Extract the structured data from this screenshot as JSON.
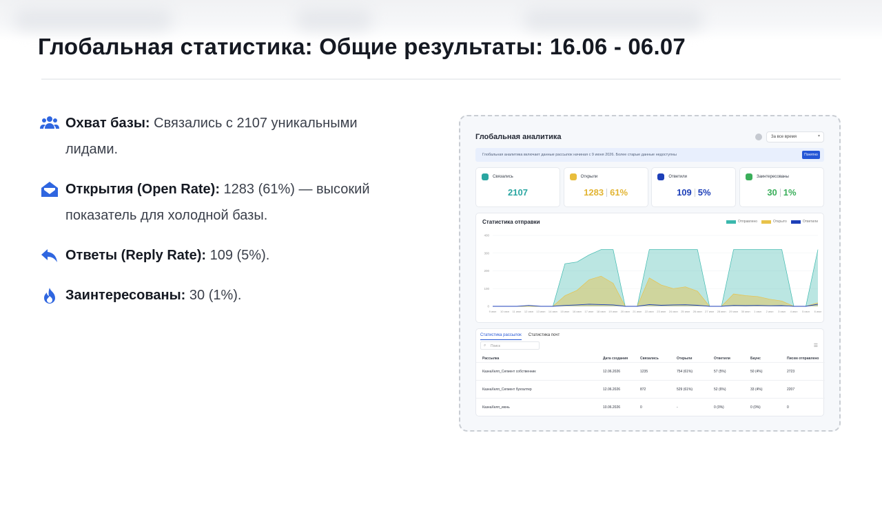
{
  "page": {
    "title": "Глобальная статистика: Общие результаты: 16.06 - 06.07",
    "stats": [
      {
        "icon": "users-icon",
        "label": "Охват базы:",
        "text": " Связались с 2107 уникальными лидами."
      },
      {
        "icon": "envelope-open-icon",
        "label": "Открытия (Open Rate):",
        "text": " 1283 (61%) — высокий показатель для холодной базы."
      },
      {
        "icon": "reply-icon",
        "label": "Ответы (Reply Rate):",
        "text": " 109 (5%)."
      },
      {
        "icon": "fire-icon",
        "label": "Заинтересованы:",
        "text": " 30 (1%)."
      }
    ]
  },
  "analytics": {
    "title": "Глобальная аналитика",
    "period": "За все время",
    "notice": "Глобальная аналитика включает данные рассылок начиная с 9 июня 2026. Более старые данные недоступны",
    "notice_button": "Понятно",
    "kpis": [
      {
        "label": "Связались",
        "value": "2107",
        "color": "#2aa6a1"
      },
      {
        "label": "Открыли",
        "value": "1283",
        "pct": "61%",
        "color": "#e8bd3c"
      },
      {
        "label": "Ответили",
        "value": "109",
        "pct": "5%",
        "color": "#1d3fb8"
      },
      {
        "label": "Заинтересованы",
        "value": "30",
        "pct": "1%",
        "color": "#3aae5a"
      }
    ],
    "table": {
      "tabs": [
        "Статистика рассылок",
        "Статистика почт"
      ],
      "search_placeholder": "Поиск",
      "headers": [
        "Рассылка",
        "Дата создания",
        "Связались",
        "Открыли",
        "Ответили",
        "Баунс",
        "Писем отправлено"
      ],
      "rows": [
        [
          "КазнаХелп_Сегмент собственник",
          "12.06.2026",
          "1235",
          "754 (61%)",
          "57 (5%)",
          "50 (4%)",
          "2723"
        ],
        [
          "КазнаХелп_Сегмент бухгалтер",
          "12.06.2026",
          "872",
          "529 (61%)",
          "52 (6%)",
          "33 (4%)",
          "2207"
        ],
        [
          "КазнаХелп_июнь",
          "10.06.2026",
          "0",
          "-",
          "0 (0%)",
          "0 (0%)",
          "0"
        ]
      ]
    }
  },
  "chart_data": {
    "type": "area",
    "title": "Статистика отправки",
    "categories": [
      "9 июн",
      "10 июн",
      "11 июн",
      "12 июн",
      "13 июн",
      "14 июн",
      "15 июн",
      "16 июн",
      "17 июн",
      "18 июн",
      "19 июн",
      "20 июн",
      "21 июн",
      "22 июн",
      "23 июн",
      "24 июн",
      "25 июн",
      "26 июн",
      "27 июн",
      "28 июн",
      "29 июн",
      "30 июн",
      "1 июл",
      "2 июл",
      "3 июл",
      "4 июл",
      "5 июл",
      "6 июл"
    ],
    "yticks": [
      0,
      100,
      200,
      300,
      400
    ],
    "ylim": [
      0,
      400
    ],
    "series": [
      {
        "name": "Отправлено",
        "color": "#3bb8ad",
        "values": [
          0,
          0,
          0,
          0,
          0,
          0,
          240,
          250,
          290,
          320,
          320,
          0,
          0,
          320,
          320,
          320,
          320,
          320,
          0,
          0,
          320,
          320,
          320,
          320,
          320,
          0,
          0,
          320
        ]
      },
      {
        "name": "Открыто",
        "color": "#e8c24a",
        "values": [
          0,
          0,
          0,
          0,
          0,
          0,
          60,
          90,
          150,
          170,
          130,
          0,
          0,
          160,
          120,
          100,
          110,
          85,
          0,
          0,
          70,
          60,
          55,
          40,
          30,
          0,
          0,
          20
        ]
      },
      {
        "name": "Ответили",
        "color": "#1d3fb8",
        "values": [
          0,
          0,
          0,
          5,
          0,
          0,
          5,
          8,
          12,
          10,
          8,
          0,
          0,
          10,
          6,
          8,
          9,
          6,
          0,
          0,
          5,
          4,
          5,
          3,
          4,
          0,
          0,
          12
        ]
      }
    ]
  }
}
